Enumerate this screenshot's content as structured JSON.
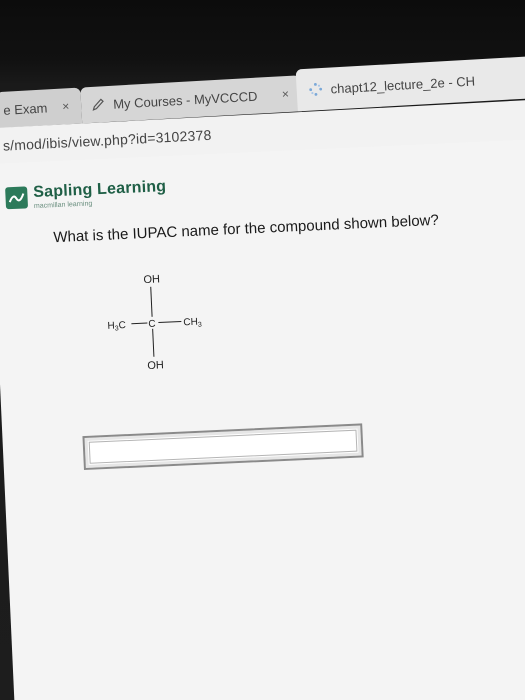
{
  "browser": {
    "tabs": [
      {
        "label": "e Exam",
        "close": "×"
      },
      {
        "label": "My Courses - MyVCCCD",
        "close": "×"
      },
      {
        "label": "chapt12_lecture_2e - CH",
        "close": "×"
      }
    ],
    "url": "s/mod/ibis/view.php?id=3102378"
  },
  "brand": {
    "name": "Sapling Learning",
    "subtitle": "macmillan learning"
  },
  "question": {
    "text": "What is the IUPAC name for the compound shown below?"
  },
  "molecule": {
    "top_group": "OH",
    "bottom_group": "OH",
    "left_group": "H3C",
    "center_atom": "C",
    "right_group": "CH3"
  },
  "answer": {
    "value": ""
  },
  "colors": {
    "brand_green": "#2c7a5a",
    "page_bg": "#f4f4f4"
  }
}
